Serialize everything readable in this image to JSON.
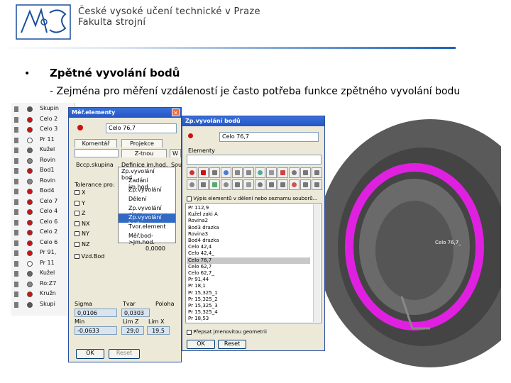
{
  "header": {
    "line1": "České vysoké učení technické v Praze",
    "line2": "Fakulta strojní"
  },
  "slide": {
    "bullet": "•",
    "heading": "Zpětné vyvolání bodů",
    "subline": "- Zejména pro měření vzdáleností je často potřeba funkce zpětného vyvolání bodu"
  },
  "tree": {
    "items": [
      "Skupin",
      "Celo 2",
      "Celo 3",
      "Pr 11",
      "Kužel",
      "Rovin",
      "Bod1",
      "Rovin",
      "Bod4",
      "Celo 7",
      "Celo 4",
      "Celo 6",
      "Celo 2",
      "Celo 6",
      "Pr 91,",
      "Pr 11",
      "Kužel",
      "Ro:Z7",
      "Kružn",
      "Skupi"
    ]
  },
  "mereni": {
    "title": "Měř.elementy",
    "value": "Celo 76,7",
    "tab_komentar": "Komentář",
    "tab_projekce": "Projekce",
    "tab_zatnou": "Z-tnou",
    "tab_v": "W",
    "label_skupina": "Bccp.skupina",
    "label_definice": "Definice jm.hod.",
    "label_sou": "Sou",
    "label_tolerance": "Tolerance pro:",
    "axes": [
      "X",
      "Y",
      "Z",
      "NX",
      "NY",
      "NZ"
    ],
    "chk_vzdbod": "Vzd.Bod",
    "val_zero": "0,0000",
    "lbl_sigma": "Sigma",
    "lbl_tvar": "Tvar",
    "lbl_poloha": "Poloha",
    "val_sigma": "0,0106",
    "val_tvar": "0,0303",
    "lbl_min": "Min",
    "lbl_lim_z": "Lim Z",
    "lbl_lim_x": "Lim X",
    "val_min": "-0,0633",
    "val_lim_z": "29,0",
    "val_lim_x": "19,5",
    "ok": "OK",
    "reset": "Reset"
  },
  "dropdown": {
    "items": [
      "Zadání jm.hod.",
      "Zp.vyvolání",
      "Dělení",
      "Zp.vyvolání elem",
      "Zp.vyvolání bodu",
      "Tvor.element",
      "Měř.bod->Jm.hod."
    ],
    "selected_index": 4,
    "top_item": "Zp.vyvolání bod"
  },
  "zpvyv": {
    "title": "Zp.vyvolání bodů",
    "value": "Celo 76,7",
    "label_elementy": "Elementy",
    "chk_vypis": "Výpis elementů v dělení nebo seznamu souborů...",
    "list": [
      "Pr 112,9",
      "Kužel zaki A",
      "Rovina2",
      "Bod3 drazka",
      "Rovina3",
      "Bod4 drazka",
      "Celo 42,4",
      "Celo 42,4_",
      "Celo 76,7",
      "Celo 62,7",
      "Celo 62,7_",
      "Pr 91,44",
      "Pr 18,1",
      "Pr 15,325_1",
      "Pr 15,325_2",
      "Pr 15,325_3",
      "Pr 15,325_4",
      "Pr 18,53"
    ],
    "selected_index": 8,
    "chk_prepsat": "Přepsat jmenovitou geometrii",
    "ok": "OK",
    "reset": "Reset"
  },
  "viewport": {
    "label": "Celo 76,7_",
    "ring_color": "#e020e0"
  }
}
